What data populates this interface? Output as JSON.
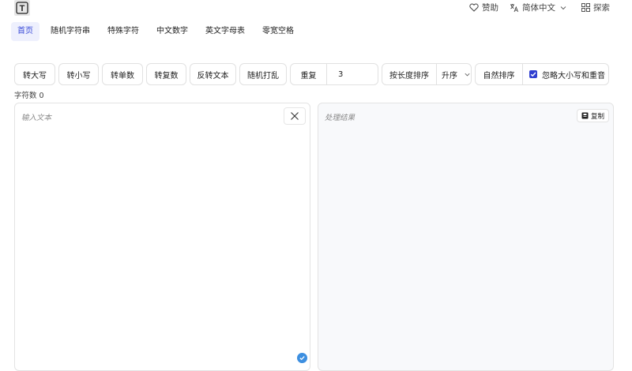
{
  "header": {
    "logo_letter": "T",
    "sponsor": "赞助",
    "language": "简体中文",
    "explore": "探索"
  },
  "nav": {
    "tabs": [
      {
        "label": "首页",
        "active": true
      },
      {
        "label": "随机字符串",
        "active": false
      },
      {
        "label": "特殊字符",
        "active": false
      },
      {
        "label": "中文数字",
        "active": false
      },
      {
        "label": "英文字母表",
        "active": false
      },
      {
        "label": "零宽空格",
        "active": false
      }
    ]
  },
  "toolbar": {
    "uppercase": "转大写",
    "lowercase": "转小写",
    "singular": "转单数",
    "plural": "转复数",
    "reverse": "反转文本",
    "shuffle": "随机打乱",
    "repeat_label": "重复",
    "repeat_value": "3",
    "sort_by_length": "按长度排序",
    "sort_order": "升序",
    "natural_sort": "自然排序",
    "ignore_case_label": "忽略大小写和重音",
    "ignore_case_checked": true
  },
  "stats": {
    "char_count": "字符数 0"
  },
  "input_panel": {
    "placeholder": "输入文本"
  },
  "output_panel": {
    "placeholder": "处理结果",
    "copy_label": "复制"
  },
  "colors": {
    "accent": "#3a4bd8",
    "checkbox": "#2f3fd0",
    "status_check": "#3d8fe0"
  }
}
